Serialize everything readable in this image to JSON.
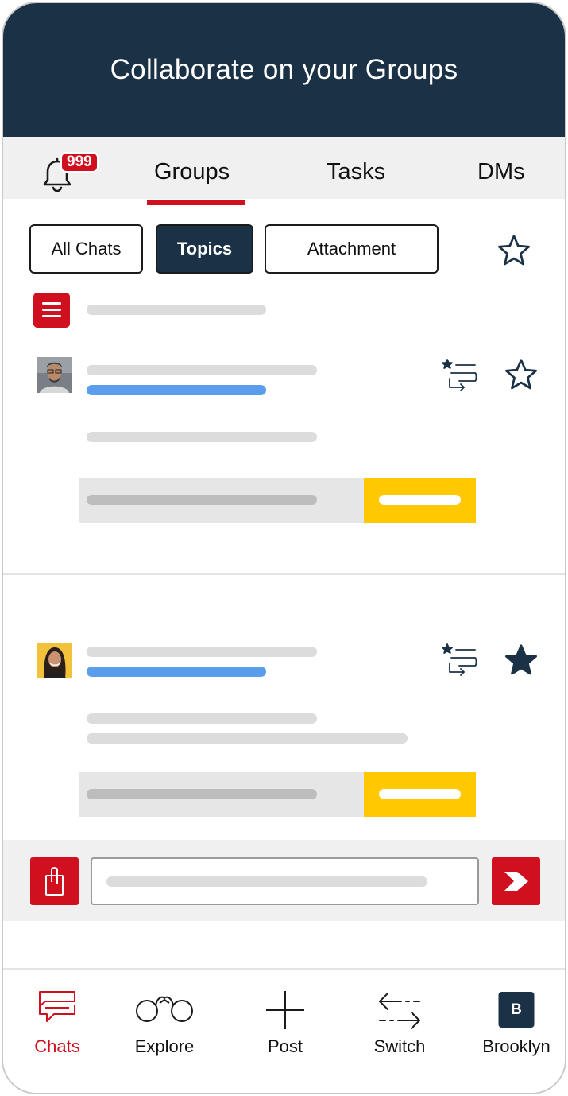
{
  "header": {
    "title": "Collaborate on your Groups"
  },
  "tabs": {
    "notification_count": "999",
    "items": [
      {
        "label": "Groups",
        "active": true
      },
      {
        "label": "Tasks",
        "active": false
      },
      {
        "label": "DMs",
        "active": false
      }
    ]
  },
  "filters": {
    "items": [
      {
        "label": "All Chats",
        "active": false
      },
      {
        "label": "Topics",
        "active": true
      },
      {
        "label": "Attachment",
        "active": false
      }
    ]
  },
  "posts": [
    {
      "starred": false,
      "avatar": "man-with-glasses"
    },
    {
      "starred": true,
      "avatar": "woman-yellow-background"
    }
  ],
  "colors": {
    "header_bg": "#1b3146",
    "accent_red": "#d0101f",
    "reply_yellow": "#ffc800",
    "link_blue": "#5b9ded"
  },
  "bottom_nav": {
    "items": [
      {
        "label": "Chats",
        "icon": "chats-icon",
        "active": true
      },
      {
        "label": "Explore",
        "icon": "binoculars-icon",
        "active": false
      },
      {
        "label": "Post",
        "icon": "plus-icon",
        "active": false
      },
      {
        "label": "Switch",
        "icon": "switch-arrows-icon",
        "active": false
      },
      {
        "label": "Brooklyn",
        "icon": "workspace-avatar",
        "avatar_letter": "B",
        "active": false
      }
    ]
  }
}
